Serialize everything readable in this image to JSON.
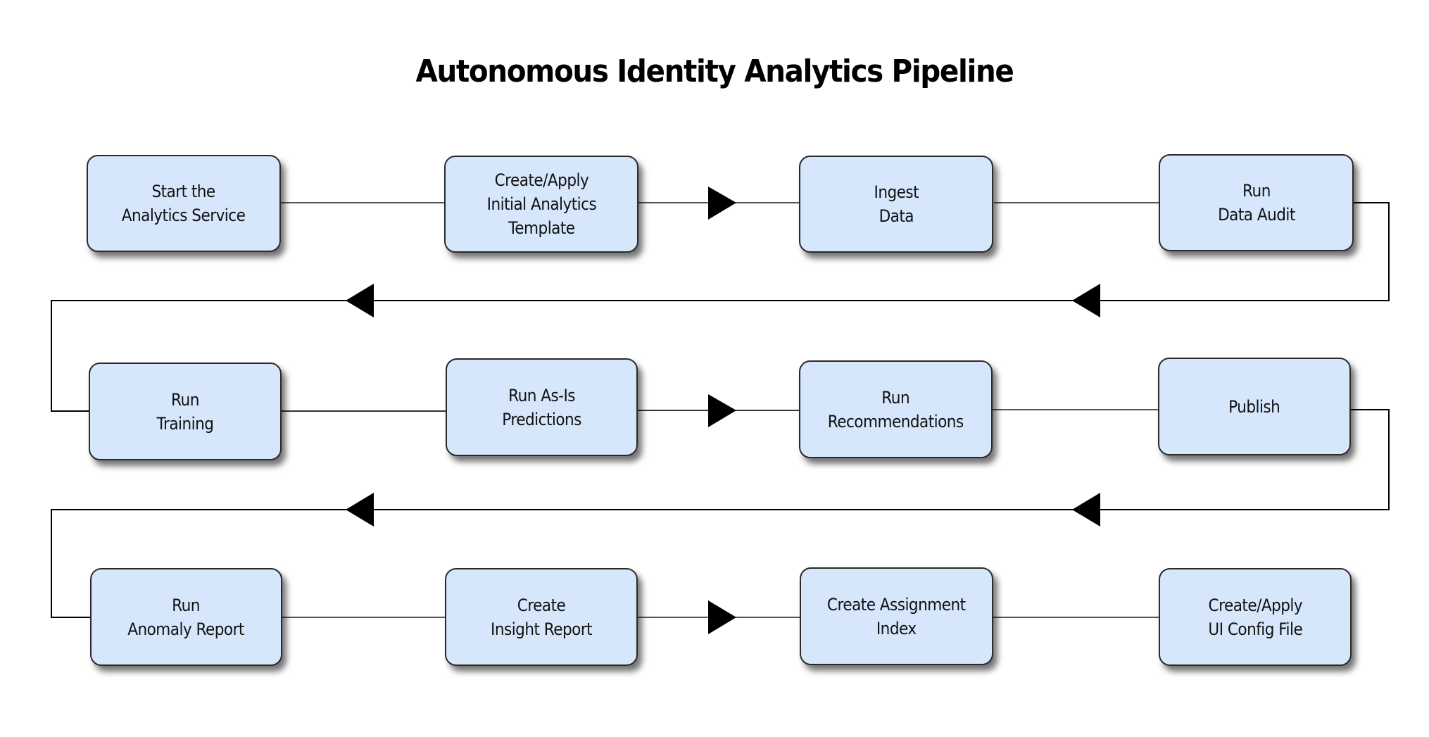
{
  "title": "Autonomous Identity Analytics Pipeline",
  "colors": {
    "node_fill": "#d6e7fc",
    "node_border": "#2a2a2a",
    "connector": "#000000",
    "arrowhead": "#000000"
  },
  "rows": [
    {
      "direction": "left-to-right",
      "nodes": [
        {
          "label": "Start the\nAnalytics Service"
        },
        {
          "label": "Create/Apply\nInitial Analytics\nTemplate"
        },
        {
          "label": "Ingest\nData"
        },
        {
          "label": "Run\nData Audit"
        }
      ]
    },
    {
      "direction": "left-to-right",
      "nodes": [
        {
          "label": "Run\nTraining"
        },
        {
          "label": "Run As-Is\nPredictions"
        },
        {
          "label": "Run\nRecommendations"
        },
        {
          "label": "Publish"
        }
      ]
    },
    {
      "direction": "left-to-right",
      "nodes": [
        {
          "label": "Run\nAnomaly Report"
        },
        {
          "label": "Create\nInsight Report"
        },
        {
          "label": "Create Assignment\nIndex"
        },
        {
          "label": "Create/Apply\nUI Config File"
        }
      ]
    }
  ],
  "flow": [
    "Start the Analytics Service",
    "Create/Apply Initial Analytics Template",
    "Ingest Data",
    "Run Data Audit",
    "Run Training",
    "Run As-Is Predictions",
    "Run Recommendations",
    "Publish",
    "Run Anomaly Report",
    "Create Insight Report",
    "Create Assignment Index",
    "Create/Apply UI Config File"
  ]
}
